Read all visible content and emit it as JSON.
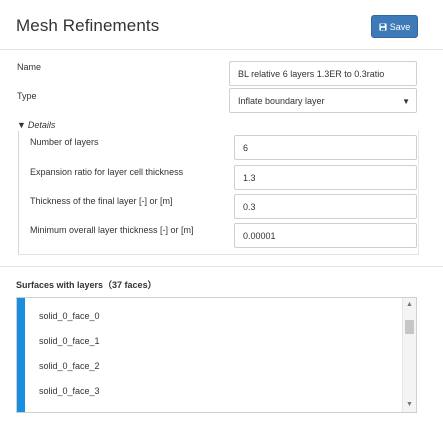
{
  "header": {
    "title": "Mesh Refinements",
    "save_label": "Save",
    "save_icon": "floppy-disk-icon",
    "accent_color": "#3f7ab8"
  },
  "form": {
    "name_label": "Name",
    "name_value": "BL relative 6 layers 1.3ER to 0.3ratio",
    "type_label": "Type",
    "type_value": "Inflate boundary layer"
  },
  "details": {
    "toggle_label": "Details",
    "fields": [
      {
        "label": "Number of layers",
        "value": "6"
      },
      {
        "label": "Expansion ratio for layer cell thickness",
        "value": "1.3"
      },
      {
        "label": "Thickness of the final layer [-] or [m]",
        "value": "0.3"
      },
      {
        "label": "Minimum overall layer thickness [-] or [m]",
        "value": "0.00001"
      }
    ]
  },
  "surfaces": {
    "title": "Surfaces with layers（37 faces）",
    "items": [
      "solid_0_face_0",
      "solid_0_face_1",
      "solid_0_face_2",
      "solid_0_face_3"
    ],
    "accent_color": "#1a8fe0"
  }
}
